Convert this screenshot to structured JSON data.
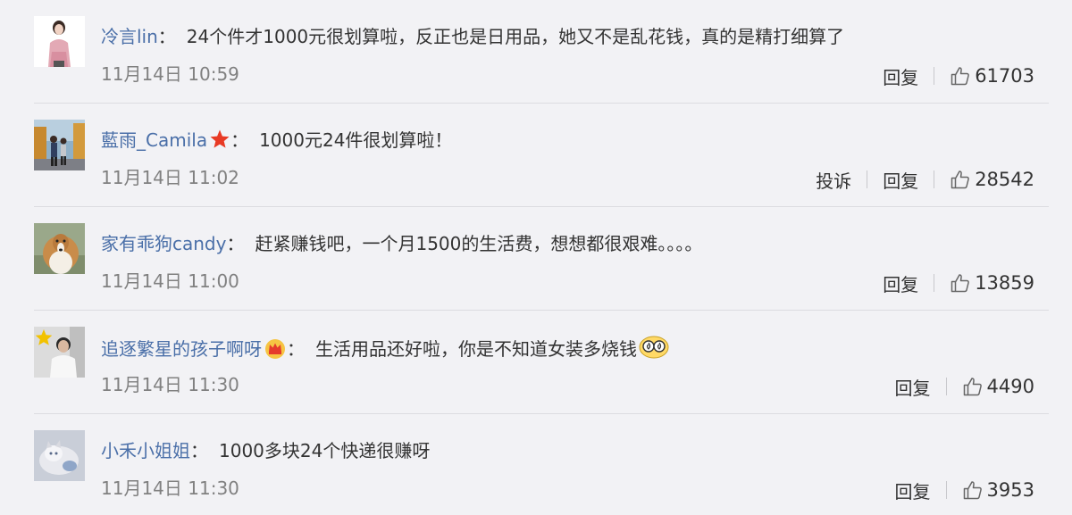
{
  "comments": [
    {
      "username": "冷言lin",
      "separator": "：",
      "text": "24个件才1000元很划算啦，反正也是日用品，她又不是乱花钱，真的是精打细算了",
      "time": "11月14日 10:59",
      "reply_label": "回复",
      "likes": "61703",
      "avatar_icon": "woman-portrait",
      "badge_icon": null,
      "has_report": false
    },
    {
      "username": "藍雨_Camila",
      "separator": "：",
      "text": "1000元24件很划算啦！",
      "time": "11月14日 11:02",
      "report_label": "投诉",
      "reply_label": "回复",
      "likes": "28542",
      "avatar_icon": "couple-walking-photo",
      "badge_icon": "red-star-icon",
      "has_report": true
    },
    {
      "username": "家有乖狗candy",
      "separator": "：",
      "text": "赶紧赚钱吧，一个月1500的生活费，想想都很艰难。。。。",
      "time": "11月14日 11:00",
      "reply_label": "回复",
      "likes": "13859",
      "avatar_icon": "collie-dog-photo",
      "badge_icon": null,
      "has_report": false
    },
    {
      "username": "追逐繁星的孩子啊呀",
      "separator": "：",
      "text": "生活用品还好啦，你是不知道女装多烧钱",
      "time": "11月14日 11:30",
      "reply_label": "回复",
      "likes": "4490",
      "avatar_icon": "man-with-star-photo",
      "badge_icon": "crown-icon",
      "emoji_icon": "dizzy-eyes-emoji",
      "has_report": false
    },
    {
      "username": "小禾小姐姐",
      "separator": "：",
      "text": "1000多块24个快递很赚呀",
      "time": "11月14日 11:30",
      "reply_label": "回复",
      "likes": "3953",
      "avatar_icon": "cat-photo",
      "badge_icon": null,
      "has_report": false
    }
  ],
  "colors": {
    "background": "#f2f2f5",
    "username": "#4a6fa8",
    "text": "#333333",
    "time": "#808080",
    "divider": "#dcdce0"
  }
}
